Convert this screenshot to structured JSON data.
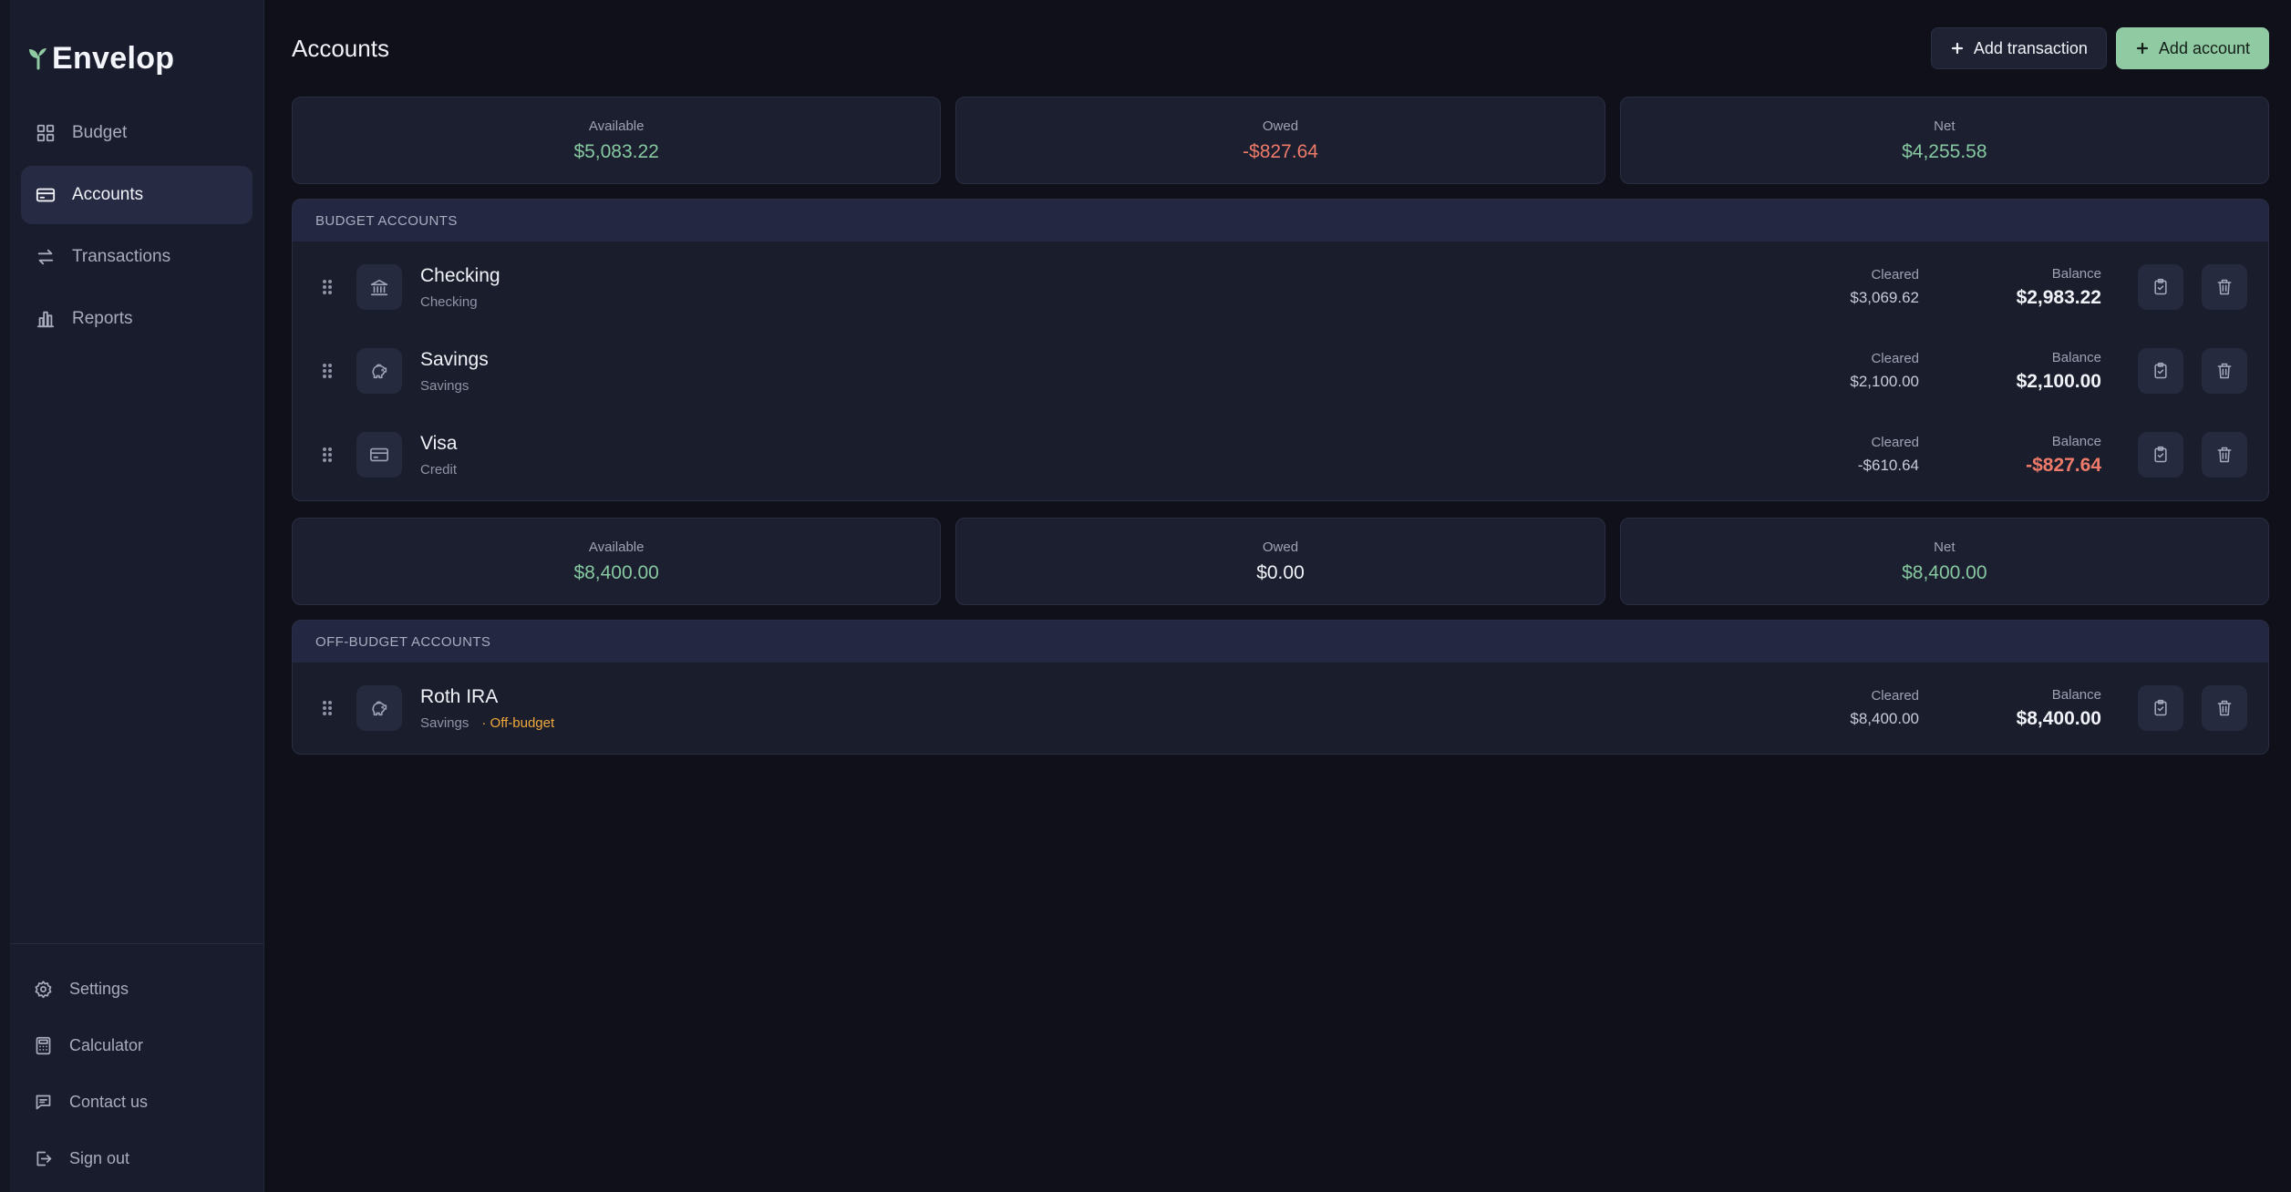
{
  "brand": {
    "name": "Envelop",
    "accent": "#8fcaa3"
  },
  "nav": [
    {
      "label": "Budget",
      "icon": "grid-icon",
      "active": false
    },
    {
      "label": "Accounts",
      "icon": "card-icon",
      "active": true
    },
    {
      "label": "Transactions",
      "icon": "arrows-icon",
      "active": false
    },
    {
      "label": "Reports",
      "icon": "bar-chart-icon",
      "active": false
    }
  ],
  "sidebar_bottom": [
    {
      "label": "Settings",
      "icon": "gear-icon"
    },
    {
      "label": "Calculator",
      "icon": "calculator-icon"
    },
    {
      "label": "Contact us",
      "icon": "message-icon"
    },
    {
      "label": "Sign out",
      "icon": "sign-out-icon"
    }
  ],
  "header": {
    "title": "Accounts",
    "add_transaction": "Add transaction",
    "add_account": "Add account"
  },
  "budget_summary": {
    "available_label": "Available",
    "available": "$5,083.22",
    "owed_label": "Owed",
    "owed": "-$827.64",
    "net_label": "Net",
    "net": "$4,255.58"
  },
  "budget_group": {
    "title": "BUDGET ACCOUNTS",
    "accounts": [
      {
        "name": "Checking",
        "type": "Checking",
        "icon": "bank-icon",
        "cleared_label": "Cleared",
        "cleared": "$3,069.62",
        "balance_label": "Balance",
        "balance": "$2,983.22"
      },
      {
        "name": "Savings",
        "type": "Savings",
        "icon": "piggy-bank-icon",
        "cleared_label": "Cleared",
        "cleared": "$2,100.00",
        "balance_label": "Balance",
        "balance": "$2,100.00"
      },
      {
        "name": "Visa",
        "type": "Credit",
        "icon": "credit-card-icon",
        "cleared_label": "Cleared",
        "cleared": "-$610.64",
        "balance_label": "Balance",
        "balance": "-$827.64"
      }
    ]
  },
  "offbudget_summary": {
    "available_label": "Available",
    "available": "$8,400.00",
    "owed_label": "Owed",
    "owed": "$0.00",
    "net_label": "Net",
    "net": "$8,400.00"
  },
  "offbudget_group": {
    "title": "OFF-BUDGET ACCOUNTS",
    "accounts": [
      {
        "name": "Roth IRA",
        "type": "Savings",
        "flag": "· Off-budget",
        "icon": "piggy-bank-icon",
        "cleared_label": "Cleared",
        "cleared": "$8,400.00",
        "balance_label": "Balance",
        "balance": "$8,400.00"
      }
    ]
  },
  "colors": {
    "positive": "#86c9a1",
    "negative": "#ee7a6a",
    "warning": "#f0a93c"
  }
}
